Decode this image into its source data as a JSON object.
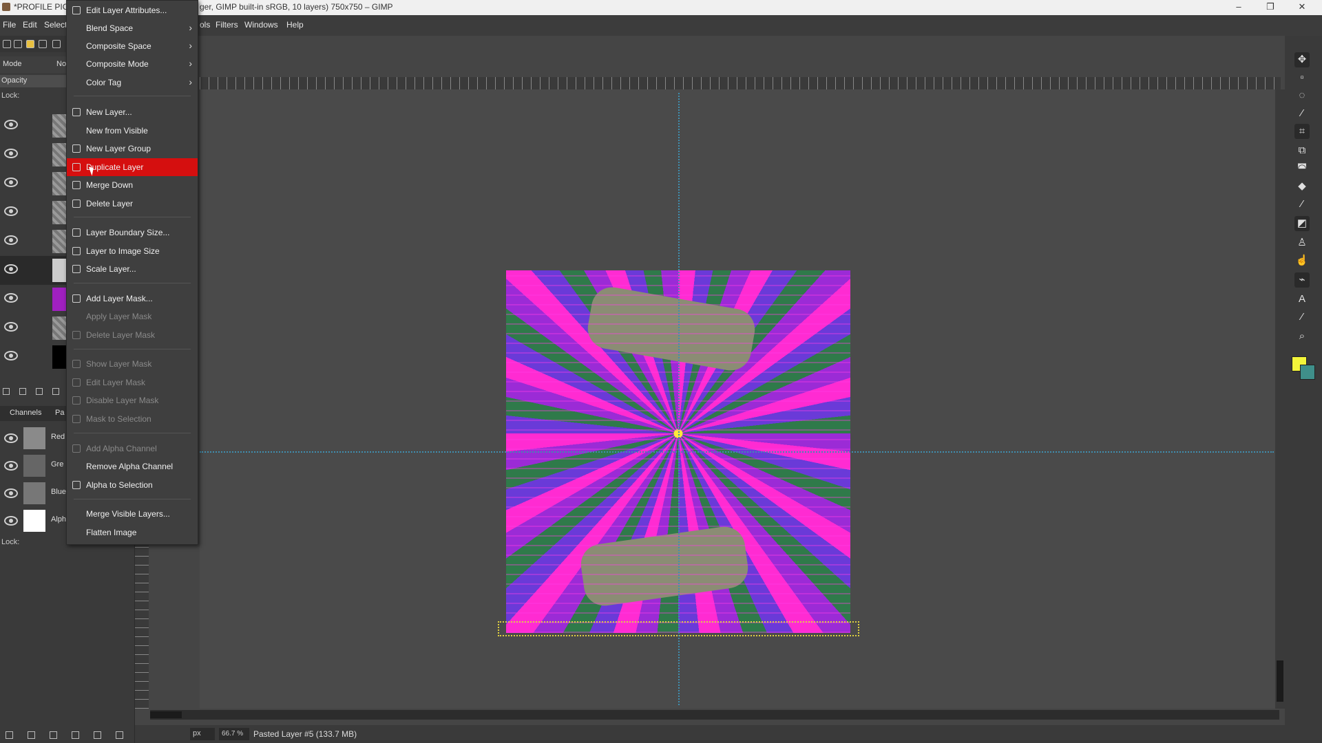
{
  "titlebar": {
    "left_text": "*PROFILE PIC",
    "right_text": "ger, GIMP built-in sRGB, 10 layers) 750x750 – GIMP",
    "minimize": "–",
    "restore": "❐",
    "close": "✕"
  },
  "menubar": {
    "file": "File",
    "edit": "Edit",
    "select": "Select",
    "tools_fragment": "ols",
    "filters": "Filters",
    "windows": "Windows",
    "help": "Help"
  },
  "layers_panel": {
    "mode_label": "Mode",
    "mode_value": "No",
    "opacity_label": "Opacity",
    "lock_label": "Lock:",
    "layer_count_visible": 9,
    "selected_index": 5
  },
  "channels_panel": {
    "tab_label": "Channels",
    "tab_second": "Pa",
    "channels": [
      "Red",
      "Gre",
      "Blue",
      "Alph"
    ],
    "lock_label": "Lock:"
  },
  "context_menu": {
    "items": [
      {
        "label": "Edit Layer Attributes...",
        "submenu": false,
        "disabled": false,
        "icon": "edit-icon"
      },
      {
        "label": "Blend Space",
        "submenu": true,
        "disabled": false,
        "icon": ""
      },
      {
        "label": "Composite Space",
        "submenu": true,
        "disabled": false,
        "icon": ""
      },
      {
        "label": "Composite Mode",
        "submenu": true,
        "disabled": false,
        "icon": ""
      },
      {
        "label": "Color Tag",
        "submenu": true,
        "disabled": false,
        "icon": ""
      },
      {
        "label": "New Layer...",
        "submenu": false,
        "disabled": false,
        "icon": "new-layer-icon"
      },
      {
        "label": "New from Visible",
        "submenu": false,
        "disabled": false,
        "icon": ""
      },
      {
        "label": "New Layer Group",
        "submenu": false,
        "disabled": false,
        "icon": "layer-group-icon"
      },
      {
        "label": "Duplicate Layer",
        "submenu": false,
        "disabled": false,
        "icon": "duplicate-icon",
        "highlighted": true
      },
      {
        "label": "Merge Down",
        "submenu": false,
        "disabled": false,
        "icon": "merge-down-icon"
      },
      {
        "label": "Delete Layer",
        "submenu": false,
        "disabled": false,
        "icon": "delete-icon"
      },
      {
        "label": "Layer Boundary Size...",
        "submenu": false,
        "disabled": false,
        "icon": "boundary-icon"
      },
      {
        "label": "Layer to Image Size",
        "submenu": false,
        "disabled": false,
        "icon": "image-size-icon"
      },
      {
        "label": "Scale Layer...",
        "submenu": false,
        "disabled": false,
        "icon": "scale-icon"
      },
      {
        "label": "Add Layer Mask...",
        "submenu": false,
        "disabled": false,
        "icon": "mask-icon"
      },
      {
        "label": "Apply Layer Mask",
        "submenu": false,
        "disabled": true,
        "icon": ""
      },
      {
        "label": "Delete Layer Mask",
        "submenu": false,
        "disabled": true,
        "icon": "delete-icon"
      },
      {
        "label": "Show Layer Mask",
        "submenu": false,
        "disabled": true,
        "icon": "checkbox-icon"
      },
      {
        "label": "Edit Layer Mask",
        "submenu": false,
        "disabled": true,
        "icon": "checkbox-icon"
      },
      {
        "label": "Disable Layer Mask",
        "submenu": false,
        "disabled": true,
        "icon": "checkbox-icon"
      },
      {
        "label": "Mask to Selection",
        "submenu": false,
        "disabled": true,
        "icon": "selection-icon"
      },
      {
        "label": "Add Alpha Channel",
        "submenu": false,
        "disabled": true,
        "icon": "alpha-icon"
      },
      {
        "label": "Remove Alpha Channel",
        "submenu": false,
        "disabled": false,
        "icon": ""
      },
      {
        "label": "Alpha to Selection",
        "submenu": false,
        "disabled": false,
        "icon": "selection-icon"
      },
      {
        "label": "Merge Visible Layers...",
        "submenu": false,
        "disabled": false,
        "icon": ""
      },
      {
        "label": "Flatten Image",
        "submenu": false,
        "disabled": false,
        "icon": ""
      }
    ]
  },
  "statusbar": {
    "unit": "px",
    "zoom": "66.7 %",
    "status": "Pasted Layer #5 (133.7 MB)"
  },
  "colors": {
    "foreground": "#f3f53a",
    "background": "#3f8f8a",
    "menu_highlight": "#d50f0f",
    "guide": "#3f8fb0"
  },
  "toolbox_icons": [
    "move-icon",
    "rect-select-icon",
    "lasso-icon",
    "fuzzy-select-icon",
    "crop-icon",
    "unified-transform-icon",
    "warp-icon",
    "bucket-fill-icon",
    "paintbrush-icon",
    "eraser-icon",
    "clone-icon",
    "smudge-icon",
    "paths-icon",
    "text-icon",
    "color-picker-icon",
    "zoom-icon"
  ]
}
